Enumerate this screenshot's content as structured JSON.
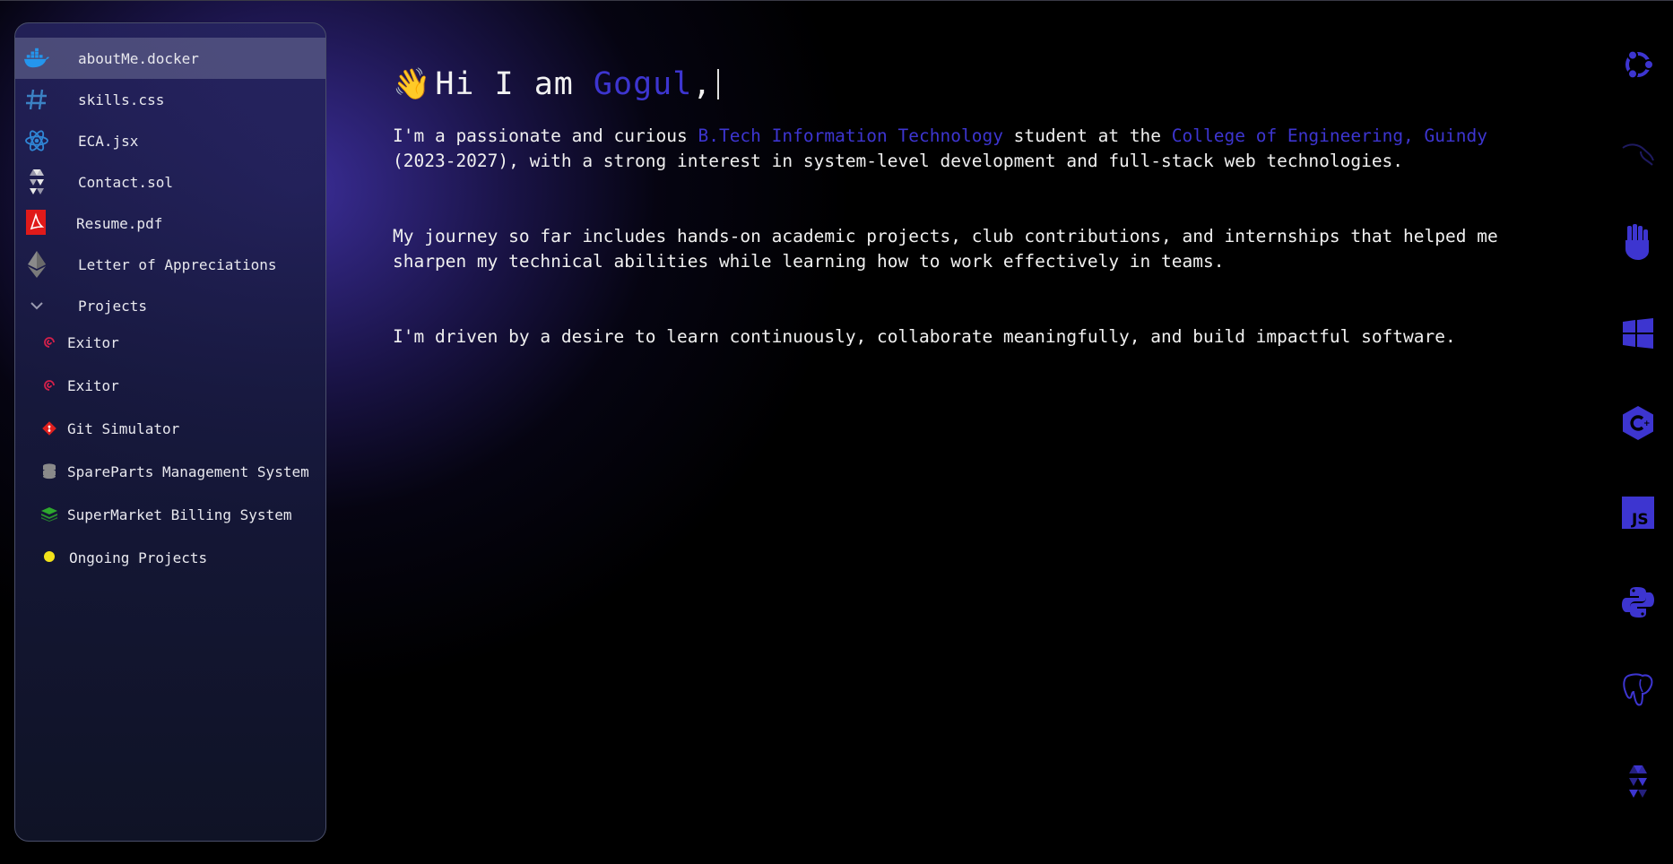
{
  "sidebar": {
    "items": [
      {
        "label": "aboutMe.docker",
        "icon": "docker-icon",
        "active": true
      },
      {
        "label": "skills.css",
        "icon": "hash-icon"
      },
      {
        "label": "ECA.jsx",
        "icon": "react-icon"
      },
      {
        "label": "Contact.sol",
        "icon": "solidity-icon"
      },
      {
        "label": "Resume.pdf",
        "icon": "pdf-icon"
      },
      {
        "label": "Letter of Appreciations",
        "icon": "ethereum-icon"
      },
      {
        "label": "Projects",
        "icon": "chevron-down-icon"
      }
    ],
    "projects": [
      {
        "label": "Exitor",
        "icon": "debian-icon"
      },
      {
        "label": "Exitor",
        "icon": "debian-icon"
      },
      {
        "label": "Git Simulator",
        "icon": "git-icon"
      },
      {
        "label": "SpareParts Management System",
        "icon": "database-icon"
      },
      {
        "label": "SuperMarket Billing System",
        "icon": "layers-icon"
      },
      {
        "label": "Ongoing Projects",
        "icon": "yellow-dot-icon"
      }
    ]
  },
  "main": {
    "greeting_emoji": "👋",
    "greeting_prefix": "Hi I am ",
    "name": "Gogul",
    "greeting_suffix": ",",
    "p1_a": "I'm a passionate and curious ",
    "p1_link1": "B.Tech Information Technology",
    "p1_b": " student at the ",
    "p1_link2": "College of Engineering, Guindy",
    "p1_c": "\n(2023-2027), with a strong interest in system-level development and full-stack web technologies.",
    "p2": "My journey so far includes hands-on academic projects, club contributions, and internships that helped me\nsharpen my technical abilities while learning how to work effectively in teams.",
    "p3": "I'm driven by a desire to learn continuously, collaborate meaningfully, and build impactful software."
  },
  "rail": {
    "icons": [
      "ubuntu-icon",
      "kali-icon",
      "hand-icon",
      "windows-icon",
      "csharp-icon",
      "javascript-icon",
      "python-icon",
      "postgresql-icon",
      "solidity-icon",
      "partial-icon"
    ]
  },
  "colors": {
    "accent": "#3d35d0",
    "background": "#000000"
  }
}
